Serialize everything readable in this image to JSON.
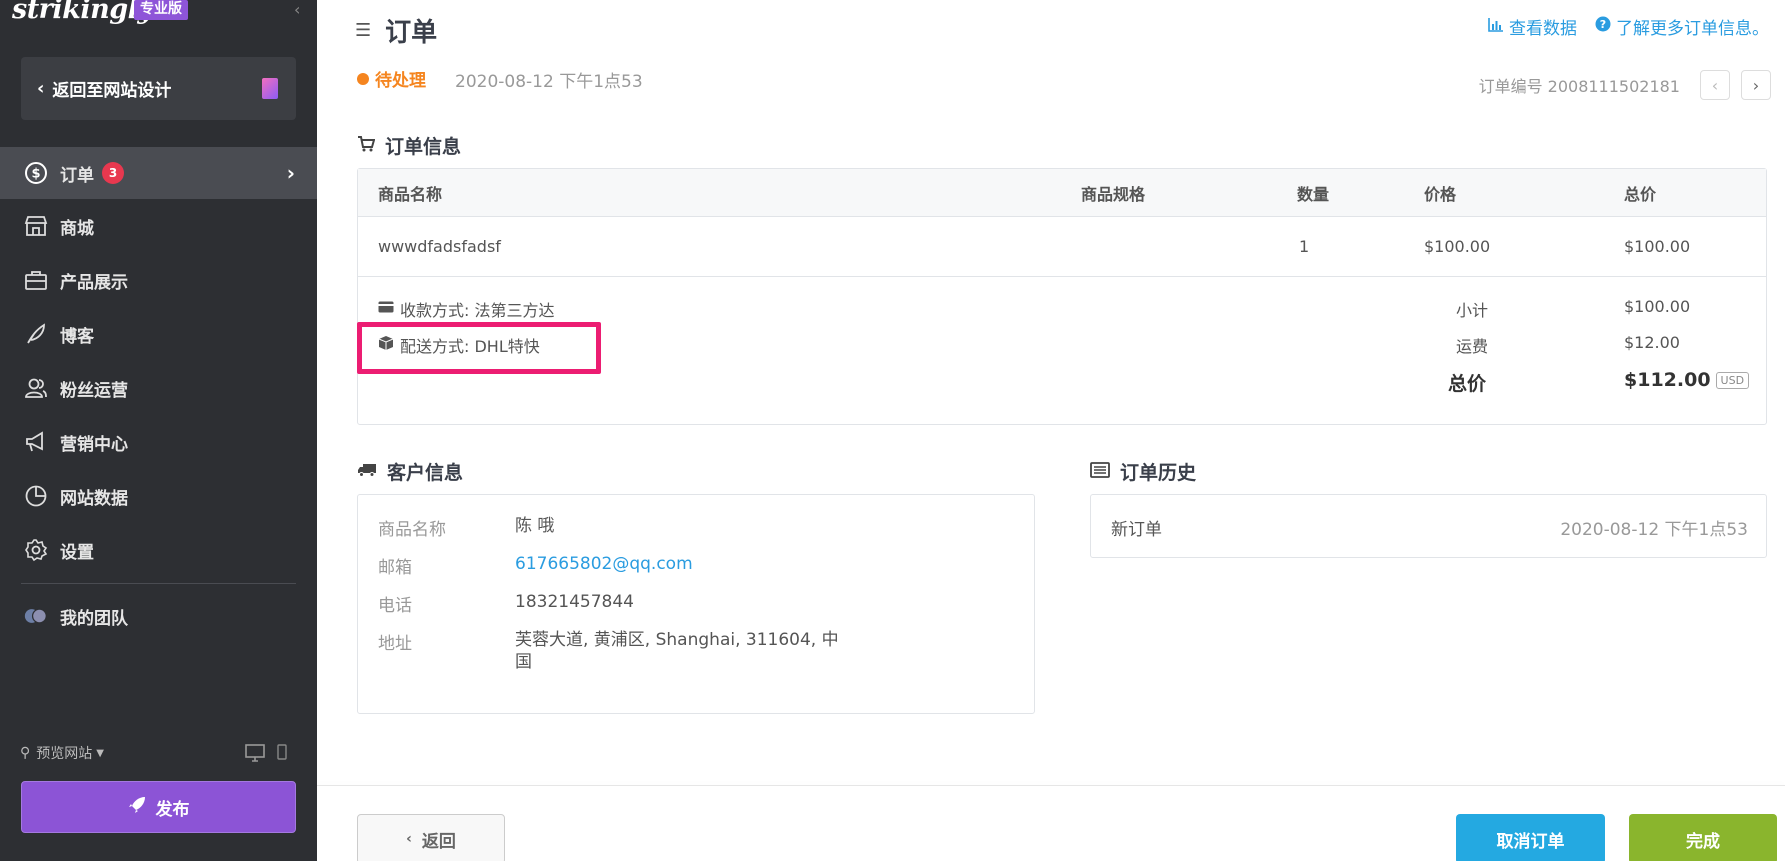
{
  "sidebar": {
    "logo": "strikingly",
    "pro_badge": "专业版",
    "back_label": "返回至网站设计",
    "items": [
      {
        "label": "订单",
        "badge": "3"
      },
      {
        "label": "商城"
      },
      {
        "label": "产品展示"
      },
      {
        "label": "博客"
      },
      {
        "label": "粉丝运营"
      },
      {
        "label": "营销中心"
      },
      {
        "label": "网站数据"
      },
      {
        "label": "设置"
      },
      {
        "label": "我的团队"
      }
    ],
    "preview_label": "预览网站",
    "publish_label": "发布"
  },
  "header": {
    "title": "订单",
    "view_data": "查看数据",
    "learn_more": "了解更多订单信息。",
    "status": "待处理",
    "status_date": "2020-08-12 下午1点53",
    "order_number": "订单编号 2008111502181"
  },
  "order_info": {
    "section_title": "订单信息",
    "columns": [
      "商品名称",
      "商品规格",
      "数量",
      "价格",
      "总价"
    ],
    "rows": [
      {
        "name": "wwwdfadsfadsf",
        "spec": "",
        "qty": "1",
        "price": "$100.00",
        "total": "$100.00"
      }
    ],
    "payment": "收款方式: 法第三方达",
    "shipping": "配送方式: DHL特快",
    "subtotal_label": "小计",
    "subtotal": "$100.00",
    "shipping_fee_label": "运费",
    "shipping_fee": "$12.00",
    "total_label": "总价",
    "total": "$112.00",
    "currency": "USD"
  },
  "customer": {
    "section_title": "客户信息",
    "name_label": "商品名称",
    "name": "陈 哦",
    "email_label": "邮箱",
    "email": "617665802@qq.com",
    "phone_label": "电话",
    "phone": "18321457844",
    "address_label": "地址",
    "address": "芙蓉大道, 黄浦区, Shanghai, 311604, 中国"
  },
  "history": {
    "section_title": "订单历史",
    "entry": "新订单",
    "date": "2020-08-12 下午1点53"
  },
  "footer": {
    "back": "返回",
    "cancel": "取消订单",
    "done": "完成"
  },
  "colors": {
    "sidebar_bg": "#2d2f33",
    "publish": "#8c54d6",
    "status": "#f5851f",
    "link": "#2a9ce0",
    "cancel": "#24a9e1",
    "done": "#8ab52d",
    "highlight": "#ec1d72"
  }
}
